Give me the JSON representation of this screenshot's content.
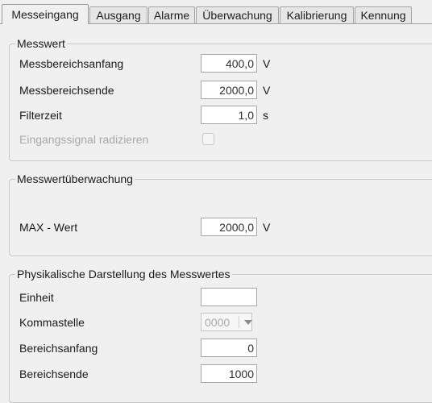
{
  "tabs": [
    {
      "label": "Messeingang",
      "active": true
    },
    {
      "label": "Ausgang",
      "active": false
    },
    {
      "label": "Alarme",
      "active": false
    },
    {
      "label": "Überwachung",
      "active": false
    },
    {
      "label": "Kalibrierung",
      "active": false
    },
    {
      "label": "Kennung",
      "active": false
    }
  ],
  "messwert": {
    "title": "Messwert",
    "messbereichsanfang": {
      "label": "Messbereichsanfang",
      "value": "400,0",
      "unit": "V"
    },
    "messbereichsende": {
      "label": "Messbereichsende",
      "value": "2000,0",
      "unit": "V"
    },
    "filterzeit": {
      "label": "Filterzeit",
      "value": "1,0",
      "unit": "s"
    },
    "radizieren": {
      "label": "Eingangssignal radizieren",
      "checked": false,
      "enabled": false
    }
  },
  "ueberwachung": {
    "title": "Messwertüberwachung",
    "max": {
      "label": "MAX - Wert",
      "value": "2000,0",
      "unit": "V"
    }
  },
  "darstellung": {
    "title": "Physikalische Darstellung des Messwertes",
    "einheit": {
      "label": "Einheit",
      "value": ""
    },
    "kommastelle": {
      "label": "Kommastelle",
      "value": "0000",
      "enabled": false
    },
    "bereichsanfang": {
      "label": "Bereichsanfang",
      "value": "0"
    },
    "bereichsende": {
      "label": "Bereichsende",
      "value": "1000"
    }
  }
}
